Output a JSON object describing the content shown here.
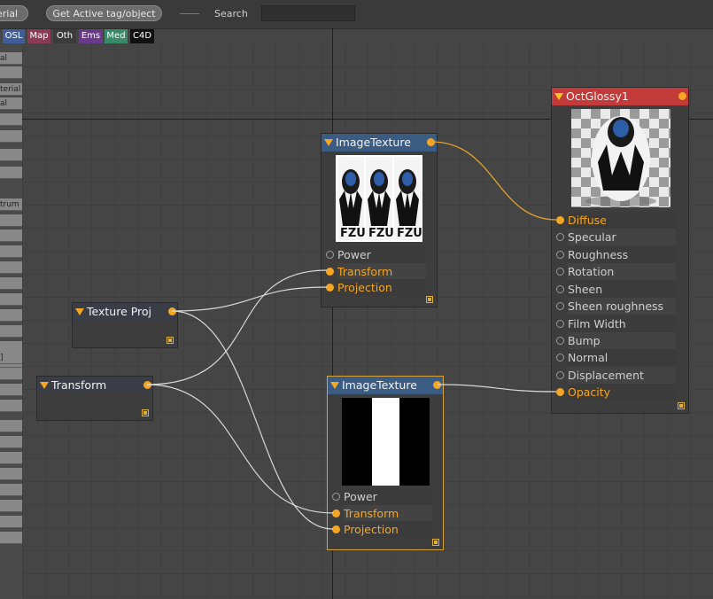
{
  "toolbar": {
    "material_btn_label": "erial",
    "get_active_label": "Get Active tag/object",
    "search_label": "Search",
    "search_value": ""
  },
  "tags": [
    {
      "label": "OSL",
      "color": "#3f5f9a"
    },
    {
      "label": "Map",
      "color": "#8a3a52"
    },
    {
      "label": "Oth",
      "color": "#3b3b3b"
    },
    {
      "label": "Ems",
      "color": "#6a3a8a"
    },
    {
      "label": "Med",
      "color": "#3a8a6a"
    },
    {
      "label": "C4D",
      "color": "#101010"
    }
  ],
  "sidebar": {
    "items": [
      "al",
      "",
      "terial",
      "al",
      "",
      "",
      "",
      "",
      "trum",
      "",
      "",
      "",
      "",
      "",
      "",
      "",
      "",
      "",
      "",
      "]",
      "",
      "",
      "",
      "",
      "",
      "",
      "",
      "",
      "",
      "",
      ""
    ]
  },
  "nodes": {
    "oct_glossy": {
      "title": "OctGlossy1",
      "header_color": "#c23a3a",
      "inputs": [
        {
          "label": "Diffuse",
          "connected": true
        },
        {
          "label": "Specular",
          "connected": false
        },
        {
          "label": "Roughness",
          "connected": false
        },
        {
          "label": "Rotation",
          "connected": false
        },
        {
          "label": "Sheen",
          "connected": false
        },
        {
          "label": "Sheen roughness",
          "connected": false
        },
        {
          "label": "Film Width",
          "connected": false
        },
        {
          "label": "Bump",
          "connected": false
        },
        {
          "label": "Normal",
          "connected": false
        },
        {
          "label": "Displacement",
          "connected": false
        },
        {
          "label": "Opacity",
          "connected": true
        }
      ]
    },
    "image_texture_1": {
      "title": "ImageTexture",
      "header_color": "#3b5c82",
      "inputs": [
        {
          "label": "Power",
          "connected": false
        },
        {
          "label": "Transform",
          "connected": true
        },
        {
          "label": "Projection",
          "connected": true
        }
      ]
    },
    "image_texture_2": {
      "title": "ImageTexture",
      "header_color": "#3b5c82",
      "inputs": [
        {
          "label": "Power",
          "connected": false
        },
        {
          "label": "Transform",
          "connected": true
        },
        {
          "label": "Projection",
          "connected": true
        }
      ]
    },
    "texture_proj": {
      "title": "Texture Proj"
    },
    "transform": {
      "title": "Transform"
    }
  },
  "colors": {
    "accent": "#f5a623",
    "canvas": "#454545",
    "wire_gold": "#e0a030",
    "wire_white": "#d8d8d8"
  }
}
